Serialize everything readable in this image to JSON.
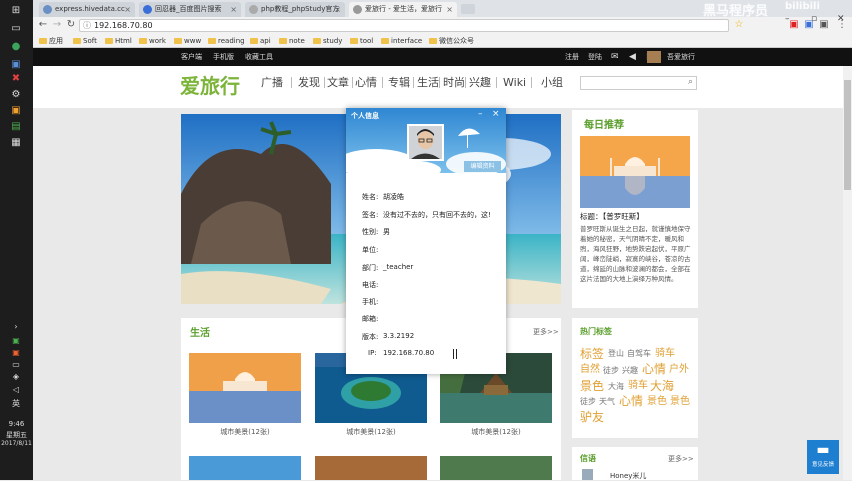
{
  "browser": {
    "tabs": [
      {
        "label": "express.hivedata.cc"
      },
      {
        "label": "回忍器_百度图片搜索"
      },
      {
        "label": "php教程_phpStudy官方"
      },
      {
        "label": "爱旅行 - 爱生活，爱旅行"
      }
    ],
    "address": "192.168.70.80",
    "bookmarks": [
      "应用",
      "Soft",
      "Html",
      "work",
      "www",
      "reading",
      "api",
      "note",
      "study",
      "tool",
      "interface",
      "微信公众号"
    ],
    "watermark": "黑马程序员",
    "watermark2": "bilibili"
  },
  "taskbar": {
    "time": "9:46",
    "weekday": "星期五",
    "date": "2017/8/11",
    "lang": "英"
  },
  "site": {
    "topbar": {
      "left": [
        "客户端",
        "手机版",
        "收藏工具"
      ],
      "right": [
        "注册",
        "登陆"
      ],
      "username": "吾爱旅行"
    },
    "logo": "爱旅行",
    "nav": [
      "广播",
      "发现",
      "文章",
      "心情",
      "专辑",
      "生活",
      "时尚",
      "兴趣",
      "Wiki",
      "小组"
    ],
    "daily": {
      "title": "每日推荐",
      "caption": "标题：【普罗旺斯】",
      "text": "普罗旺斯从诞生之日起，就谨慎地保守着她的秘密，天气阴晴不定，暖风和煦，海风狂野，地势跌宕起伏，平原广阔，峰峦陡峭，寂寞的峡谷，苍凉的古道，绵延的山脉和波澜的都会，全部在这片法国的大地上演绎万种风情。"
    },
    "life": {
      "title": "生活",
      "more": "更多>>",
      "captions": [
        "城市美景(12张)",
        "城市美景(12张)",
        "城市美景(12张)"
      ]
    },
    "tags": {
      "title": "热门标签",
      "items": [
        "标签",
        "登山",
        "自驾车",
        "骑车",
        "自然",
        "徒步",
        "兴趣",
        "心情",
        "户外",
        "景色",
        "大海",
        "骑车",
        "大海",
        "徒步",
        "天气",
        "心情",
        "景色",
        "景色",
        "驴友"
      ]
    },
    "messages": {
      "title": "信语",
      "more": "更多>>",
      "user": "Honey米儿"
    },
    "feedback": "意见反馈"
  },
  "popup": {
    "title": "个人信息",
    "edit": "编辑资料",
    "rows": [
      {
        "label": "姓名:",
        "value": "胡凌皓"
      },
      {
        "label": "签名:",
        "value": "没有过不去的，只有回不去的，这!"
      },
      {
        "label": "性别:",
        "value": "男"
      },
      {
        "label": "单位:",
        "value": ""
      },
      {
        "label": "部门:",
        "value": "_teacher"
      },
      {
        "label": "电话:",
        "value": ""
      },
      {
        "label": "手机:",
        "value": ""
      },
      {
        "label": "邮箱:",
        "value": ""
      },
      {
        "label": "版本:",
        "value": "3.3.2192"
      },
      {
        "label": "IP:",
        "value": "192.168.70.80"
      }
    ]
  }
}
